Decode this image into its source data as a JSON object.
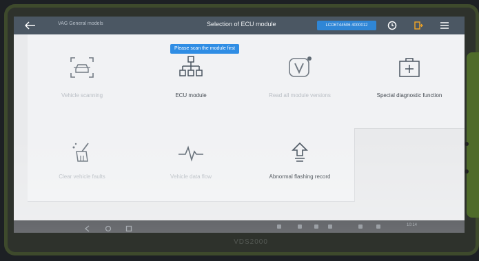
{
  "device": {
    "brand": "VDS2000"
  },
  "topbar": {
    "breadcrumb": "VAG General models",
    "title": "Selection of ECU module",
    "vin": "LCO6T44506 4000012"
  },
  "tooltip": "Please scan the module first",
  "tiles": [
    {
      "label": "Vehicle scanning",
      "icon": "car-scan-icon",
      "enabled": false
    },
    {
      "label": "ECU module",
      "icon": "ecu-tree-icon",
      "enabled": true
    },
    {
      "label": "Read all module versions",
      "icon": "version-v-icon",
      "enabled": false
    },
    {
      "label": "Special diagnostic function",
      "icon": "medical-kit-icon",
      "enabled": true
    },
    {
      "label": "Clear vehicle faults",
      "icon": "broom-icon",
      "enabled": false
    },
    {
      "label": "Vehicle data flow",
      "icon": "pulse-icon",
      "enabled": false
    },
    {
      "label": "Abnormal flashing record",
      "icon": "flash-upload-icon",
      "enabled": true
    }
  ],
  "navbar": {
    "time": "10:14"
  },
  "colors": {
    "topbar": "#4b5763",
    "accent": "#2f86d6",
    "screen": "#e9eaec"
  }
}
